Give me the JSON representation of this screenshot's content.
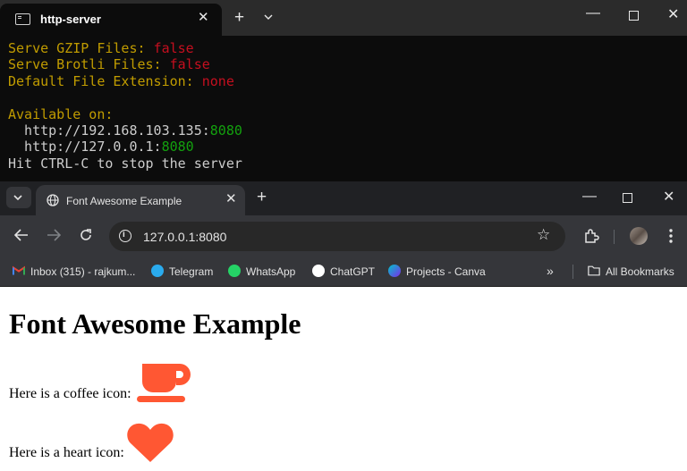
{
  "terminal": {
    "tab_title": "http-server",
    "lines": {
      "gzip_label": "Serve GZIP Files: ",
      "gzip_value": "false",
      "brotli_label": "Serve Brotli Files: ",
      "brotli_value": "false",
      "ext_label": "Default File Extension: ",
      "ext_value": "none",
      "available": "Available on:",
      "url1_host": "  http://192.168.103.135:",
      "url1_port": "8080",
      "url2_host": "  http://127.0.0.1:",
      "url2_port": "8080",
      "hint": "Hit CTRL-C to stop the server"
    },
    "colors": {
      "label": "#c19c00",
      "value": "#c50f1f",
      "port": "#13a10e",
      "text": "#cccccc"
    }
  },
  "browser": {
    "tab_title": "Font Awesome Example",
    "url": "127.0.0.1:8080",
    "bookmarks": [
      {
        "label": "Inbox (315) - rajkum...",
        "icon": "gmail-icon"
      },
      {
        "label": "Telegram",
        "icon": "telegram-icon"
      },
      {
        "label": "WhatsApp",
        "icon": "whatsapp-icon"
      },
      {
        "label": "ChatGPT",
        "icon": "chatgpt-icon"
      },
      {
        "label": "Projects - Canva",
        "icon": "canva-icon"
      }
    ],
    "all_bookmarks": "All Bookmarks"
  },
  "page": {
    "heading": "Font Awesome Example",
    "coffee_text": "Here is a coffee icon:",
    "heart_text": "Here is a heart icon:",
    "icon_color": "#ff5733"
  }
}
